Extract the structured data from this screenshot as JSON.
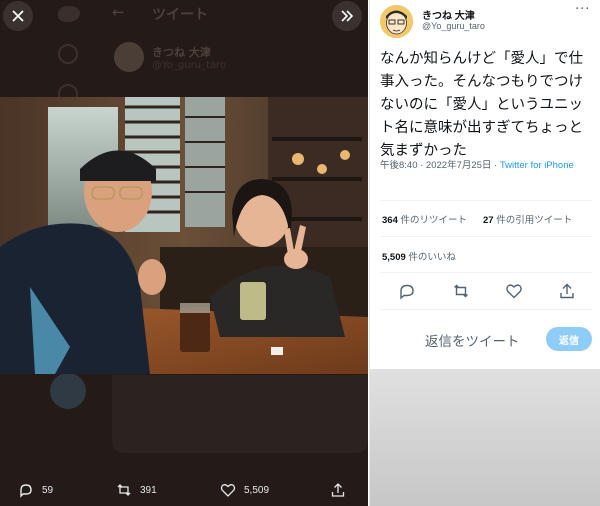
{
  "lightbox": {
    "background_header": "ツイート",
    "background_name": "きつね 大津",
    "background_handle": "@Yo_guru_taro",
    "actions": {
      "replies": "59",
      "retweets": "391",
      "likes": "5,509"
    }
  },
  "tweet": {
    "display_name": "きつね 大津",
    "handle": "@Yo_guru_taro",
    "text": "なんか知らんけど「愛人」で仕事入った。そんなつもりでつけないのに「愛人」というユニット名に意味が出すぎてちょっと気まずかった",
    "time": "午後8:40 · 2022年7月25日 · ",
    "source": "Twitter for iPhone",
    "retweets_count": "364",
    "retweets_label": "件のリツイート",
    "quotes_count": "27",
    "quotes_label": "件の引用ツイート",
    "likes_count": "5,509",
    "likes_label": "件のいいね"
  },
  "reply": {
    "placeholder": "返信をツイート",
    "button_label": "返信"
  },
  "colors": {
    "accent": "#1d9bf0",
    "reply_button": "#8ecdf8",
    "lightbox_bg": "#241a17"
  },
  "icons": {
    "close": "close-icon",
    "expand": "expand-icon",
    "reply": "reply-icon",
    "retweet": "retweet-icon",
    "like": "heart-icon",
    "share": "share-icon",
    "more": "more-icon"
  }
}
